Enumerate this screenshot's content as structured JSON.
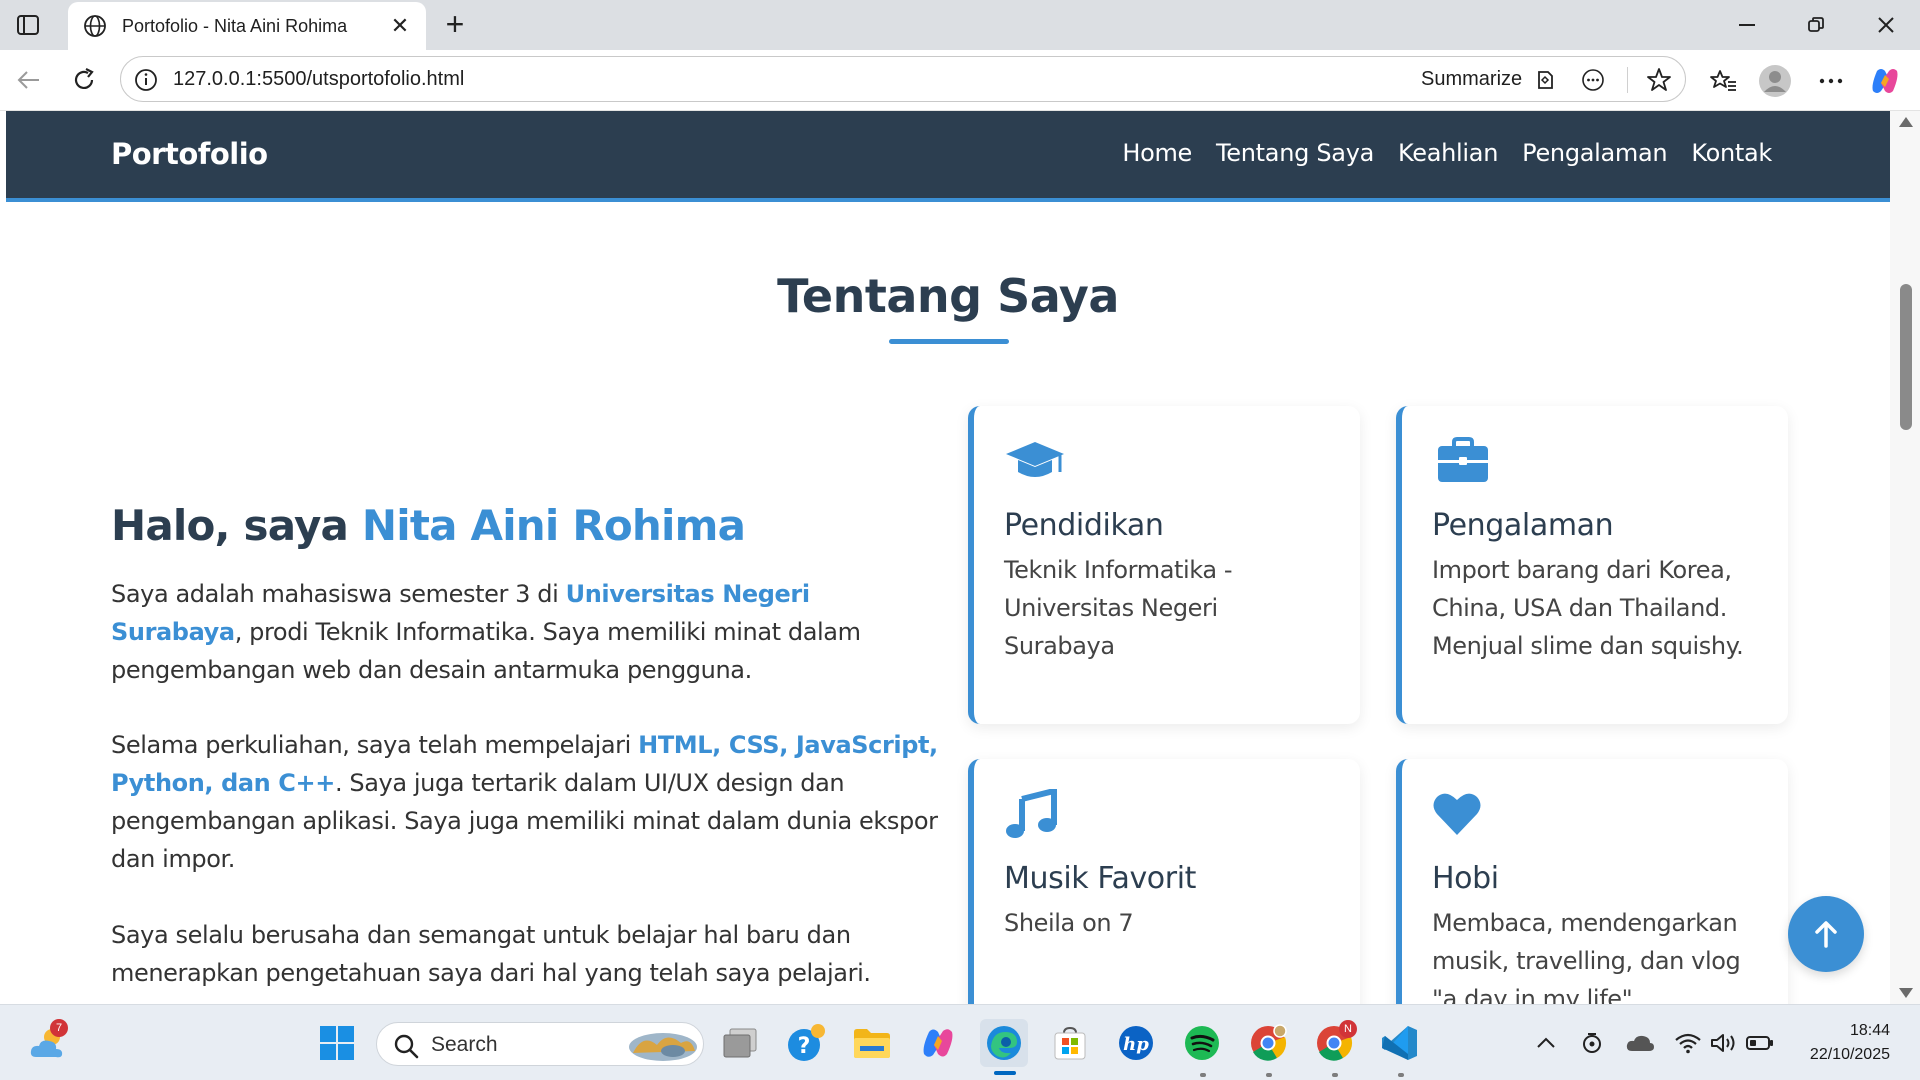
{
  "browser": {
    "tab_title": "Portofolio - Nita Aini Rohima",
    "url": "127.0.0.1:5500/utsportofolio.html",
    "summarize_label": "Summarize"
  },
  "site": {
    "brand": "Portofolio",
    "menu": [
      "Home",
      "Tentang Saya",
      "Keahlian",
      "Pengalaman",
      "Kontak"
    ],
    "section_title": "Tentang Saya",
    "intro": {
      "prefix": "Halo, saya ",
      "name": "Nita Aini Rohima"
    },
    "para1": {
      "a": "Saya adalah mahasiswa semester 3 di ",
      "b": "Universitas Negeri Surabaya",
      "c": ", prodi Teknik Informatika. Saya memiliki minat dalam pengembangan web dan desain antarmuka pengguna."
    },
    "para2": {
      "a": "Selama perkuliahan, saya telah mempelajari ",
      "b": "HTML, CSS, JavaScript, Python, dan C++",
      "c": ". Saya juga tertarik dalam UI/UX design dan pengembangan aplikasi. Saya juga memiliki minat dalam dunia ekspor dan impor."
    },
    "para3": "Saya selalu berusaha dan semangat untuk belajar hal baru dan menerapkan pengetahuan saya dari hal yang telah saya pelajari.",
    "cards": [
      {
        "icon": "graduation-cap-icon",
        "title": "Pendidikan",
        "text": "Teknik Informatika - Universitas Negeri Surabaya"
      },
      {
        "icon": "briefcase-icon",
        "title": "Pengalaman",
        "text": "Import barang dari Korea, China, USA dan Thailand. Menjual slime dan squishy."
      },
      {
        "icon": "music-note-icon",
        "title": "Musik Favorit",
        "text": "Sheila on 7"
      },
      {
        "icon": "heart-icon",
        "title": "Hobi",
        "text": "Membaca, mendengarkan musik, travelling, dan vlog \"a day in my life\""
      }
    ],
    "accent_color": "#3b8fd4",
    "nav_color": "#2c3e50"
  },
  "taskbar": {
    "search_label": "Search",
    "time": "18:44",
    "date": "22/10/2025",
    "weather_badge": "7",
    "chrome_badge": "N"
  }
}
